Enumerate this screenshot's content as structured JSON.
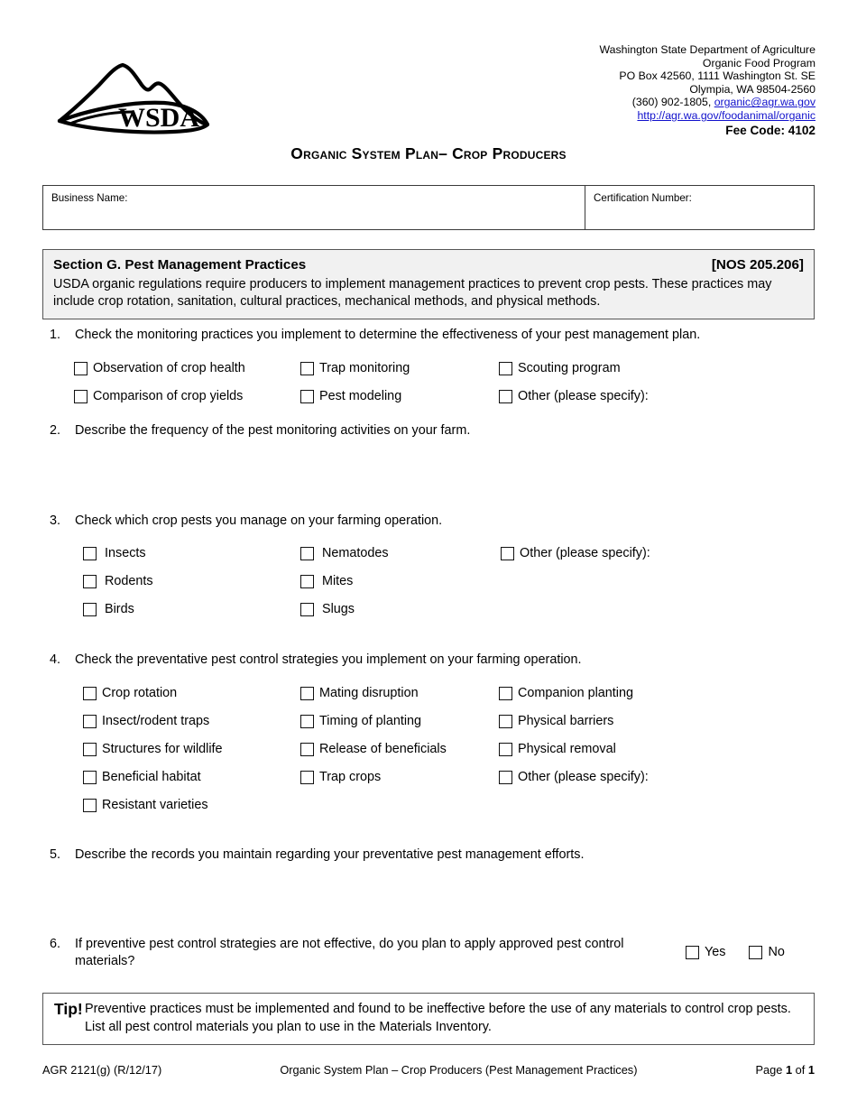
{
  "header": {
    "logo_name": "WSDA",
    "agency_lines": [
      "Washington State Department of Agriculture",
      "Organic Food Program",
      "PO Box 42560, 1111 Washington St. SE",
      "Olympia, WA 98504-2560"
    ],
    "phone_prefix": "(360) 902-1805, ",
    "email": "organic@agr.wa.gov",
    "website": "http://agr.wa.gov/foodanimal/organic",
    "fee_code": "Fee Code: 4102",
    "link_color": "#1111cc"
  },
  "title": "Organic System Plan– Crop Producers",
  "business_box": {
    "business_name_label": "Business Name:",
    "business_name_value": "",
    "certification_number_label": "Certification Number:",
    "certification_number_value": ""
  },
  "section": {
    "title": "Section G.  Pest Management Practices",
    "reference": "[NOS 205.206]",
    "description": "USDA organic regulations require producers to implement management practices to prevent crop pests. These practices may include crop rotation, sanitation, cultural practices, mechanical methods, and physical methods."
  },
  "questions": [
    {
      "number": "1.",
      "text": "Check the monitoring practices you implement to determine the effectiveness of your pest management plan.",
      "options_col1": [
        "Observation of crop health",
        "Comparison of crop yields"
      ],
      "options_col2": [
        "Trap monitoring",
        "Pest modeling"
      ],
      "options_col3": [
        "Scouting program",
        "Other (please specify):"
      ]
    },
    {
      "number": "2.",
      "text": "Describe the frequency of the pest monitoring activities on your farm.",
      "answer": ""
    },
    {
      "number": "3.",
      "text": "Check which crop pests you manage on your farming operation.",
      "options_col1": [
        "Insects",
        "Rodents",
        "Birds"
      ],
      "options_col2": [
        "Nematodes",
        "Mites",
        "Slugs"
      ],
      "options_col3": [
        "Other (please specify):"
      ]
    },
    {
      "number": "4.",
      "text": "Check the preventative pest control strategies you implement on your farming operation.",
      "options_col1": [
        "Crop rotation",
        "Insect/rodent traps",
        "Structures for wildlife",
        "Beneficial habitat",
        "Resistant varieties"
      ],
      "options_col2": [
        "Mating disruption",
        "Timing of planting",
        "Release of beneficials",
        "Trap crops"
      ],
      "options_col3": [
        "Companion planting",
        "Physical barriers",
        "Physical removal",
        "Other (please specify):"
      ]
    },
    {
      "number": "5.",
      "text": "Describe the records you maintain regarding your preventative pest management efforts.",
      "answer": ""
    },
    {
      "number": "6.",
      "text": "If preventive pest control strategies are not effective, do you plan to apply approved pest control materials?",
      "yes_label": "Yes",
      "no_label": "No"
    }
  ],
  "tip": {
    "word": "Tip!",
    "text": "Preventive practices must be implemented and found to be ineffective before the use of any materials to control crop pests. List all pest control materials you plan to use in the Materials Inventory."
  },
  "footer": {
    "form_id": "AGR 2121(g) (R/12/17)",
    "center": "Organic System Plan – Crop Producers (Pest Management Practices)",
    "page_prefix": "Page ",
    "page_current": "1",
    "page_middle": " of ",
    "page_total": "1"
  }
}
